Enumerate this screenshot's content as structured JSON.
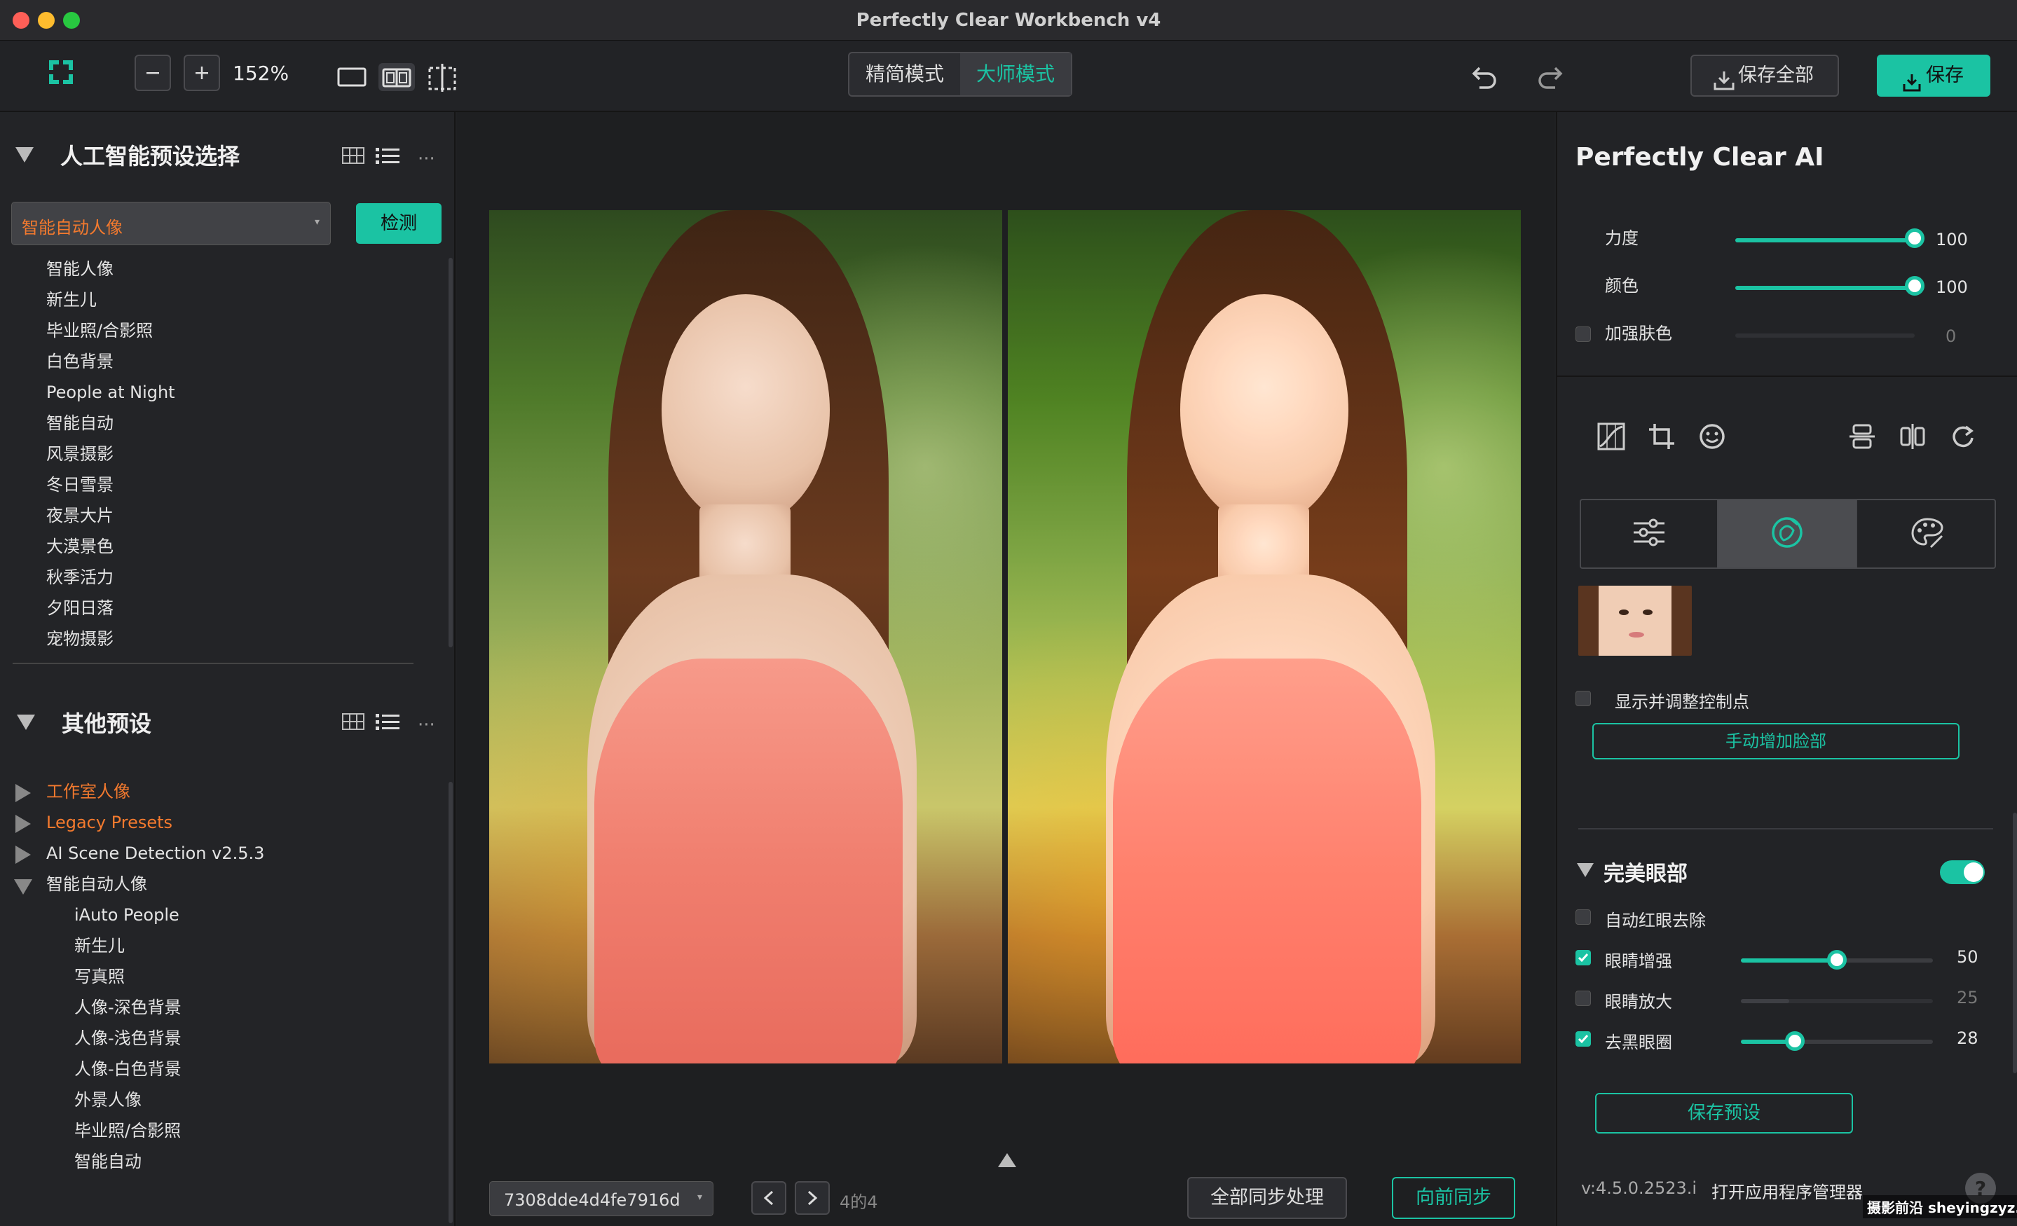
{
  "window": {
    "title": "Perfectly Clear Workbench v4"
  },
  "toolbar": {
    "zoom": "152%",
    "mode_simple": "精简模式",
    "mode_master": "大师模式",
    "save_all": "保存全部",
    "save": "保存"
  },
  "left": {
    "ai_preset_title": "人工智能预设选择",
    "preset_dropdown": "智能自动人像",
    "detect_button": "检测",
    "ai_presets": [
      "智能人像",
      "新生儿",
      "毕业照/合影照",
      "白色背景",
      "People at Night",
      "智能自动",
      "风景摄影",
      "冬日雪景",
      "夜景大片",
      "大漠景色",
      "秋季活力",
      "夕阳日落",
      "宠物摄影"
    ],
    "other_title": "其他预设",
    "groups": [
      {
        "label": "工作室人像",
        "expanded": false,
        "highlight": true
      },
      {
        "label": "Legacy Presets",
        "expanded": false,
        "highlight": true
      },
      {
        "label": "AI Scene Detection v2.5.3",
        "expanded": false,
        "highlight": false
      },
      {
        "label": "智能自动人像",
        "expanded": true,
        "highlight": false
      }
    ],
    "sub_items": [
      "iAuto People",
      "新生儿",
      "写真照",
      "人像-深色背景",
      "人像-浅色背景",
      "人像-白色背景",
      "外景人像",
      "毕业照/合影照",
      "智能自动"
    ]
  },
  "center": {
    "filename": "7308dde4d4fe7916d",
    "page_info": "4的4",
    "sync_all": "全部同步处理",
    "sync_forward": "向前同步"
  },
  "right": {
    "title": "Perfectly Clear AI",
    "strength_label": "力度",
    "strength_value": "100",
    "strength": 100,
    "color_label": "颜色",
    "color_value": "100",
    "color": 100,
    "skin_label": "加强肤色",
    "skin_value": "0",
    "show_points": "显示并调整控制点",
    "add_face": "手动增加脸部",
    "eyes_title": "完美眼部",
    "eye_rows": [
      {
        "label": "自动红眼去除",
        "checked": false,
        "value": "",
        "level": null
      },
      {
        "label": "眼睛增强",
        "checked": true,
        "value": "50",
        "level": 50
      },
      {
        "label": "眼睛放大",
        "checked": false,
        "value": "25",
        "level": 25
      },
      {
        "label": "去黑眼圈",
        "checked": true,
        "value": "28",
        "level": 28
      }
    ],
    "save_preset": "保存预设",
    "version": "v:4.5.0.2523.i",
    "open_manager": "打开应用程序管理器"
  },
  "watermark": "摄影前沿 sheyingzyz.com",
  "colors": {
    "accent": "#1bc3a3",
    "highlight": "#f47a2e"
  }
}
